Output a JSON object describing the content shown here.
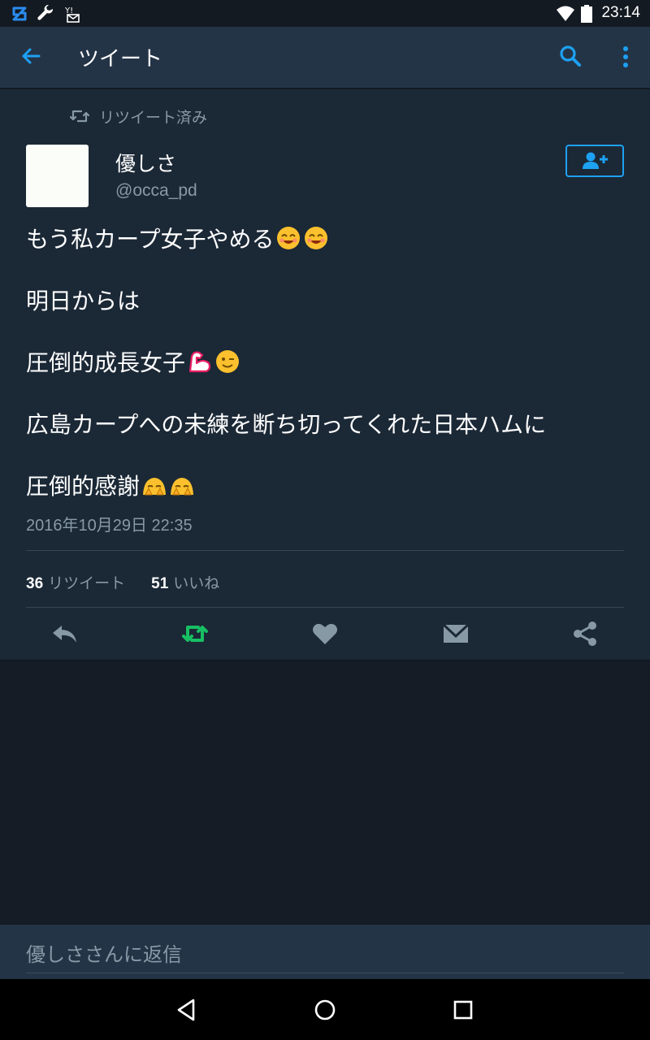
{
  "status_bar": {
    "time": "23:14",
    "left_icons": [
      "s-app-icon",
      "wrench-icon",
      "yahoo-mail-icon"
    ],
    "right_icons": [
      "wifi-icon",
      "battery-icon"
    ]
  },
  "app_bar": {
    "title": "ツイート",
    "back_icon": "arrow-left-icon",
    "search_icon": "search-icon",
    "more_icon": "more-vert-icon"
  },
  "tweet": {
    "retweeted_label": "リツイート済み",
    "user_name": "優しさ",
    "user_handle": "@occa_pd",
    "follow_icon": "add-user-icon",
    "lines": [
      "もう私カープ女子やめる",
      "明日からは",
      "圧倒的成長女子",
      "広島カープへの未練を断ち切ってくれた日本ハムに",
      "圧倒的感謝"
    ],
    "line_emojis": [
      [
        "smiling-face-emoji",
        "smiling-face-emoji"
      ],
      [],
      [
        "flexed-biceps-emoji",
        "winking-face-emoji"
      ],
      [],
      [
        "bowing-person-emoji",
        "bowing-person-emoji"
      ]
    ],
    "timestamp": "2016年10月29日 22:35",
    "retweet_count": "36",
    "retweet_label": "リツイート",
    "like_count": "51",
    "like_label": "いいね"
  },
  "actions": [
    "reply-icon",
    "retweet-icon",
    "like-icon",
    "direct-message-icon",
    "share-icon"
  ],
  "colors": {
    "accent": "#1da1f2",
    "retweeted": "#17bf63",
    "background": "#1b2836",
    "secondary_text": "#8899a6"
  },
  "reply": {
    "placeholder": "優しささんに返信"
  },
  "nav_bar": [
    "back-triangle-icon",
    "home-circle-icon",
    "recents-square-icon"
  ]
}
